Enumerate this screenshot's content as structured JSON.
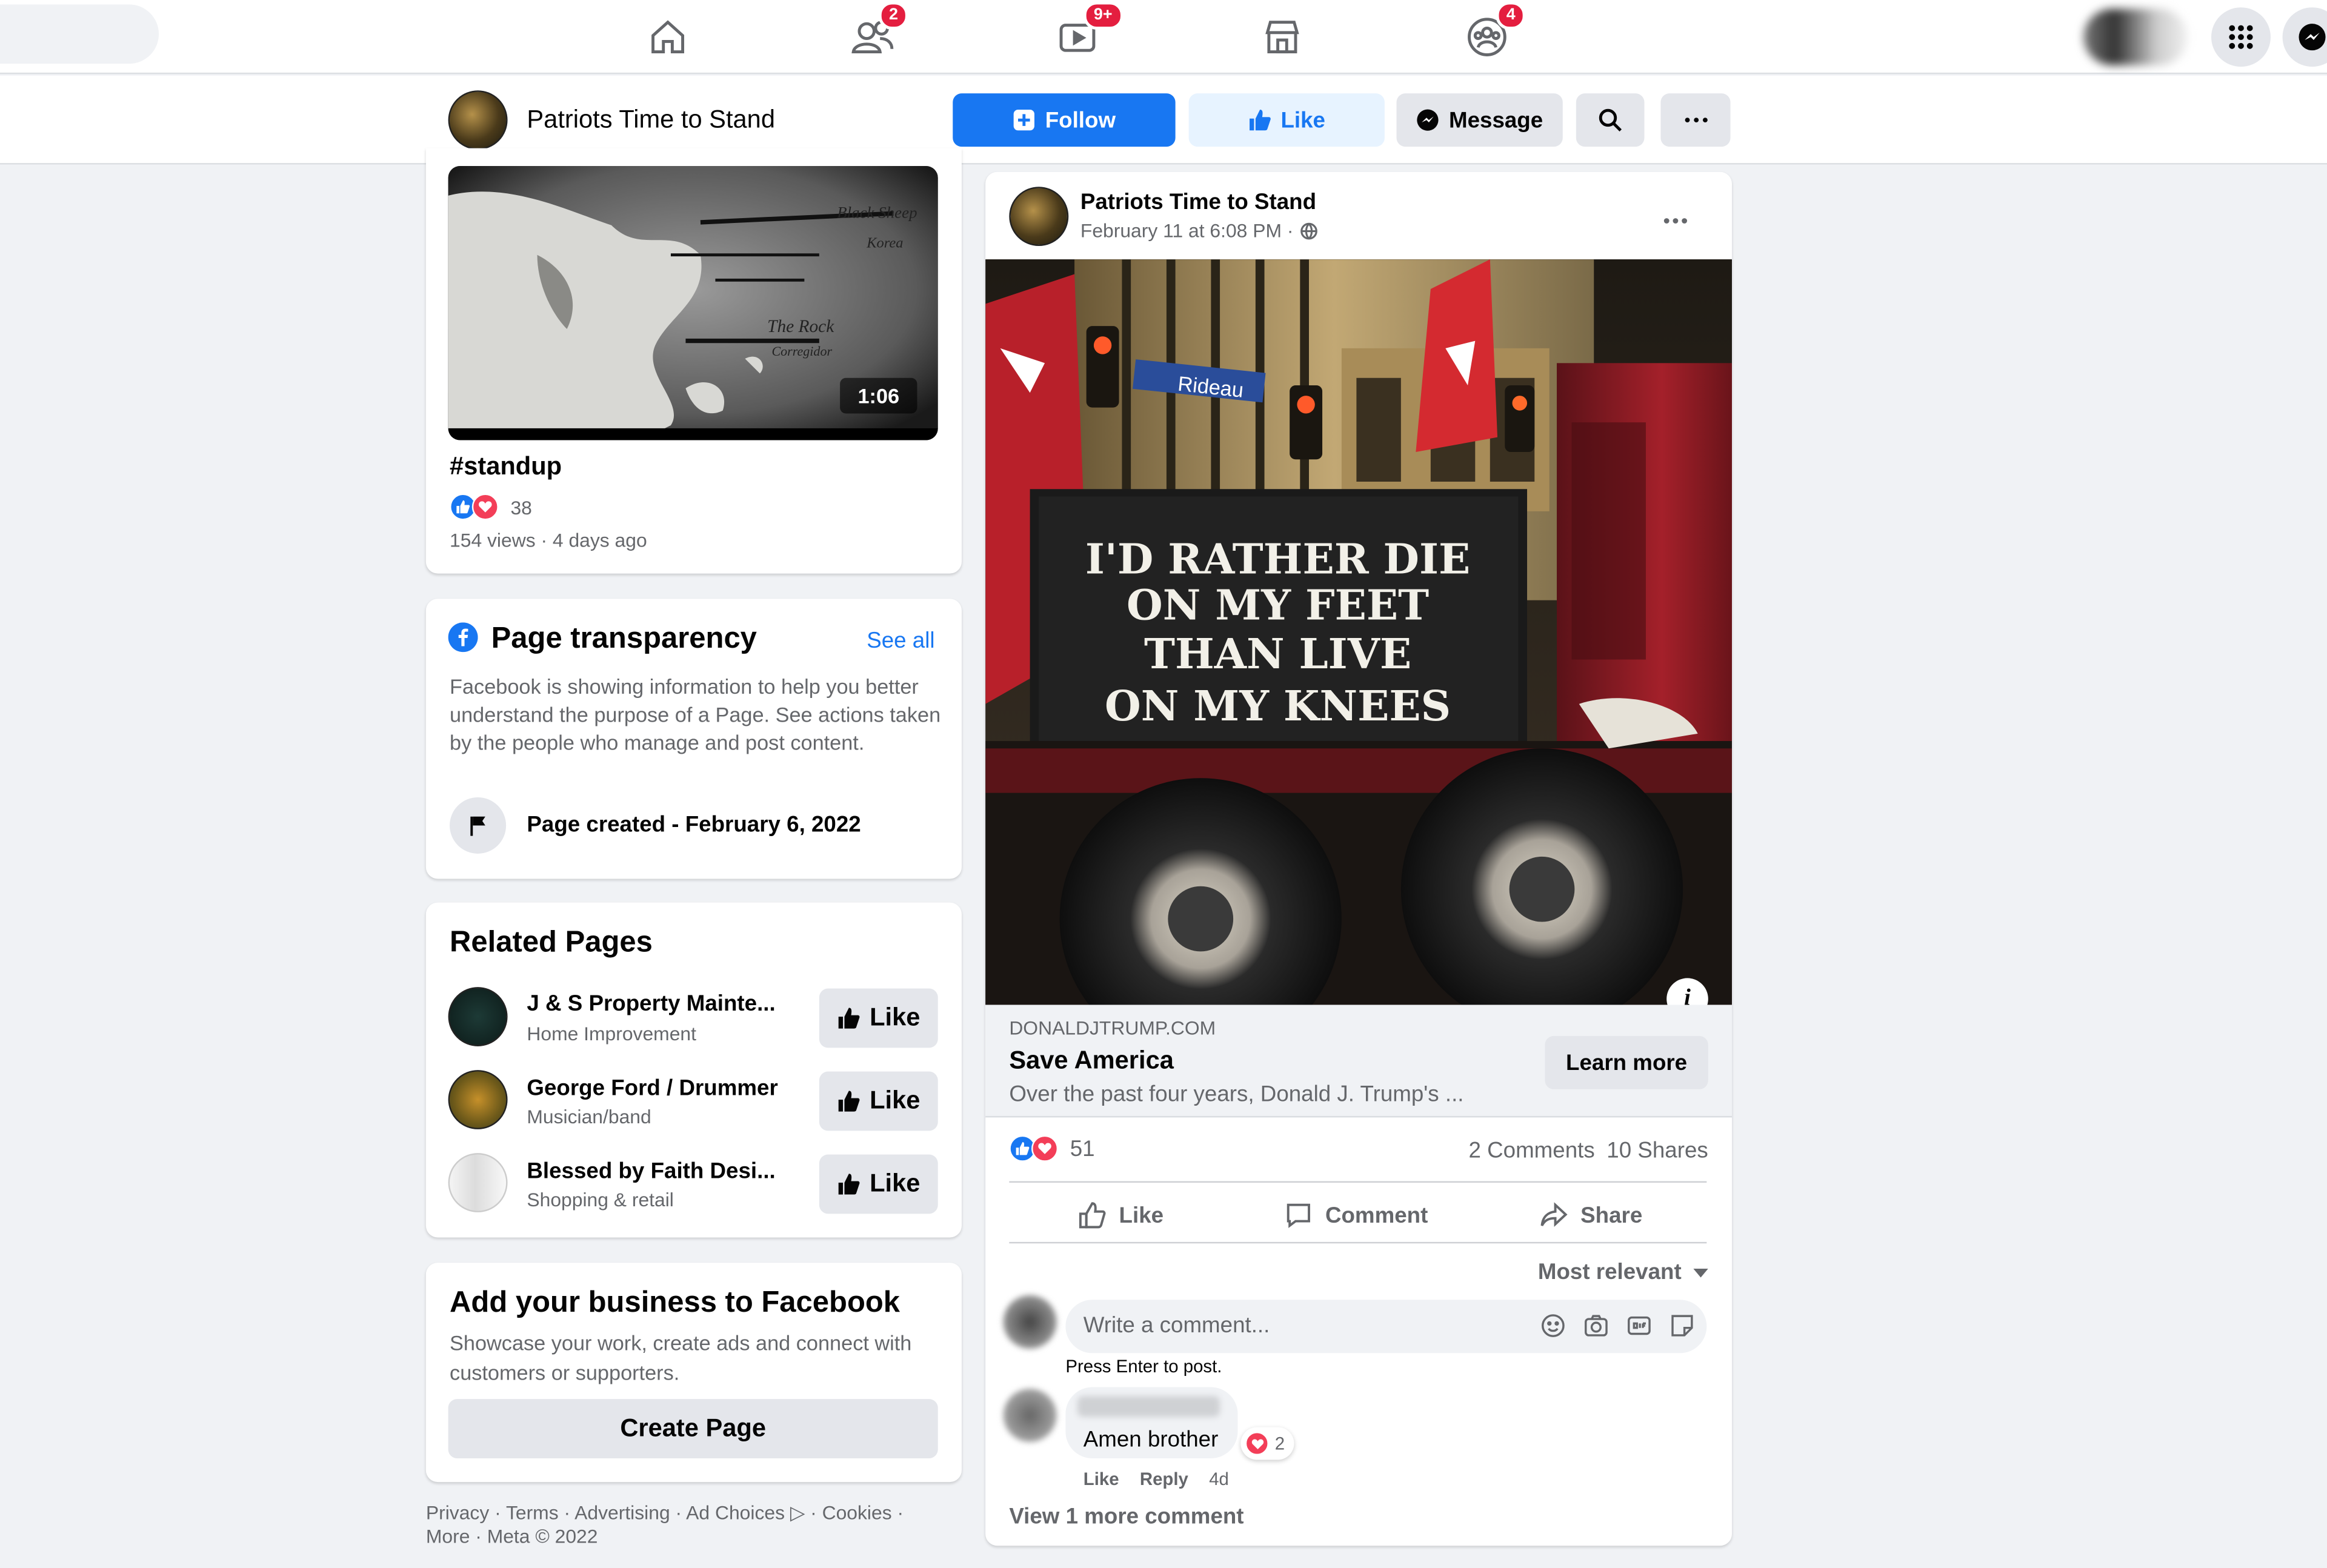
{
  "nav": {
    "badges": {
      "friends": "2",
      "watch": "9+",
      "groups": "4"
    }
  },
  "page_header": {
    "name": "Patriots Time to Stand",
    "follow_label": "Follow",
    "like_label": "Like",
    "message_label": "Message"
  },
  "video": {
    "duration": "1:06",
    "title": "#standup",
    "reactions_count": "38",
    "meta": "154 views · 4 days ago",
    "map_labels": [
      "Black Sheep",
      "Korea",
      "The Rock",
      "Corregidor"
    ]
  },
  "transparency": {
    "title": "Page transparency",
    "see_all": "See all",
    "body": "Facebook is showing information to help you better understand the purpose of a Page. See actions taken by the people who manage and post content.",
    "created": "Page created - February 6, 2022"
  },
  "related": {
    "title": "Related Pages",
    "like_label": "Like",
    "items": [
      {
        "name": "J & S Property Mainte...",
        "category": "Home Improvement"
      },
      {
        "name": "George Ford / Drummer",
        "category": "Musician/band"
      },
      {
        "name": "Blessed by Faith Desi...",
        "category": "Shopping & retail"
      }
    ]
  },
  "business": {
    "title": "Add your business to Facebook",
    "body": "Showcase your work, create ads and connect with customers or supporters.",
    "button": "Create Page"
  },
  "footer": {
    "line1": "Privacy · Terms · Advertising · Ad Choices ▷ · Cookies ·",
    "line2": "More · Meta © 2022"
  },
  "post": {
    "author": "Patriots Time to Stand",
    "timestamp": "February 11 at 6:08 PM ·",
    "image_sign": [
      "I'D RATHER DIE",
      "ON MY FEET",
      "THAN LIVE",
      "ON MY KNEES"
    ],
    "street_sign": "Rideau",
    "link_domain": "DONALDJTRUMP.COM",
    "link_title": "Save America",
    "link_desc": "Over the past four years, Donald J. Trump's ...",
    "learn_more": "Learn more",
    "reactions_count": "51",
    "comments_count": "2 Comments",
    "shares_count": "10 Shares",
    "like_label": "Like",
    "comment_label": "Comment",
    "share_label": "Share",
    "sort_label": "Most relevant",
    "comment_placeholder": "Write a comment...",
    "press_enter": "Press Enter to post.",
    "comment": {
      "text": "Amen brother",
      "reaction_count": "2",
      "like": "Like",
      "reply": "Reply",
      "age": "4d"
    },
    "view_more": "View 1 more comment"
  },
  "colors": {
    "primary": "#1877f2",
    "like_bg": "#e7f3ff",
    "secondary_bg": "#e4e6eb",
    "badge": "#e41e3f",
    "page_bg": "#f0f2f5"
  }
}
